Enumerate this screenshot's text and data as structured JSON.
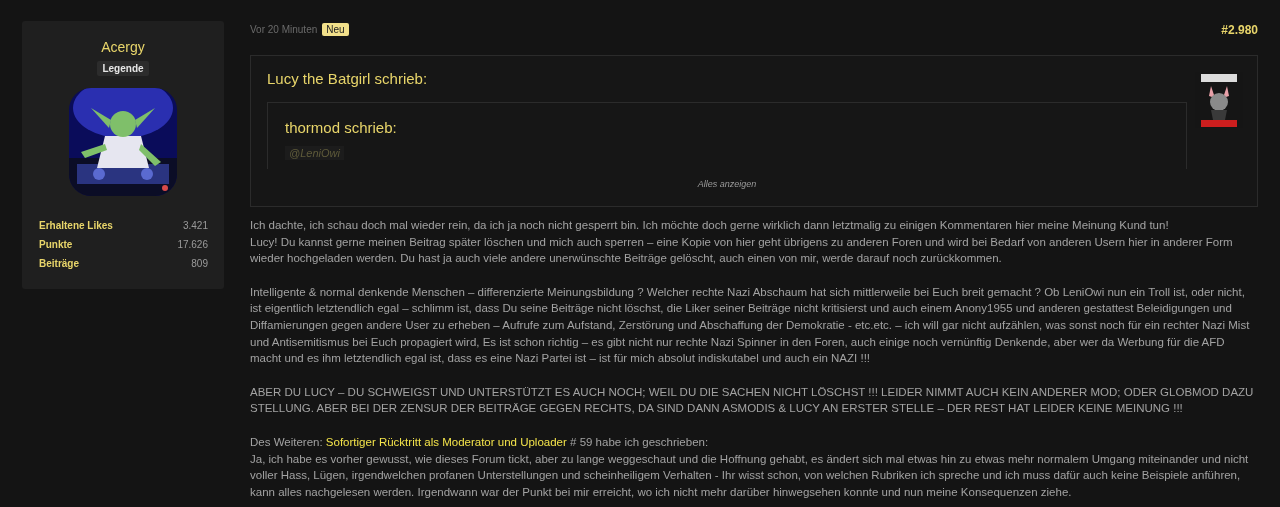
{
  "user": {
    "name": "Acergy",
    "rank": "Legende",
    "stats": [
      {
        "label": "Erhaltene Likes",
        "value": "3.421"
      },
      {
        "label": "Punkte",
        "value": "17.626"
      },
      {
        "label": "Beiträge",
        "value": "809"
      }
    ]
  },
  "post": {
    "time": "Vor 20 Minuten",
    "badge": "Neu",
    "number": "#2.980",
    "quote": {
      "author": "Lucy the Batgirl schrieb:",
      "nested": {
        "author": "thormod schrieb:",
        "mention": "@LeniOwi"
      },
      "expand": "Alles anzeigen"
    },
    "paragraphs": [
      {
        "lines": [
          {
            "text": "Ich dachte, ich schau doch mal wieder rein, da ich ja noch nicht gesperrt bin. Ich möchte doch gerne wirklich dann letztmalig zu einigen Kommentaren hier meine Meinung Kund tun!"
          },
          {
            "text": "Lucy! Du kannst gerne meinen Beitrag später löschen und mich auch sperren – eine Kopie von hier geht übrigens zu anderen Foren und wird bei Bedarf von anderen Usern hier in anderer Form wieder hochgeladen werden. Du hast ja auch viele andere unerwünschte Beiträge gelöscht, auch einen von mir, werde darauf noch zurückkommen."
          }
        ]
      },
      {
        "lines": [
          {
            "text": "Intelligente & normal denkende Menschen – differenzierte Meinungsbildung ? Welcher rechte Nazi Abschaum hat sich mittlerweile bei Euch breit gemacht ? Ob LeniOwi nun ein Troll ist, oder nicht, ist eigentlich letztendlich egal – schlimm ist, dass Du seine Beiträge nicht löschst, die Liker seiner Beiträge nicht kritisierst und auch einem Anony1955 und anderen gestattest Beleidigungen und Diffamierungen gegen andere User zu erheben – Aufrufe zum Aufstand, Zerstörung und Abschaffung der Demokratie - etc.etc. – ich will gar nicht aufzählen, was sonst noch für ein rechter Nazi Mist und Antisemitismus bei Euch propagiert wird, Es ist schon richtig – es gibt nicht nur rechte Nazi Spinner in den Foren, auch einige noch vernünftig Denkende, aber wer da Werbung für die AFD macht und es ihm letztendlich egal ist, dass es eine Nazi Partei ist – ist für mich absolut indiskutabel und auch ein NAZI !!!"
          }
        ]
      },
      {
        "lines": [
          {
            "text": "ABER DU LUCY – DU SCHWEIGST UND UNTERSTÜTZT ES AUCH NOCH; WEIL DU DIE SACHEN NICHT LÖSCHST !!! LEIDER NIMMT AUCH KEIN ANDERER MOD; ODER GLOBMOD DAZU STELLUNG. ABER BEI DER ZENSUR DER BEITRÄGE GEGEN RECHTS, DA SIND DANN ASMODIS & LUCY AN ERSTER STELLE – DER REST HAT LEIDER KEINE MEINUNG !!!"
          }
        ]
      },
      {
        "lines": [
          {
            "text": "Des Weiteren: ",
            "link": "Sofortiger Rücktritt als Moderator und Uploader",
            "after": " # 59 habe ich geschrieben:"
          },
          {
            "text": "Ja, ich habe es vorher gewusst, wie dieses Forum tickt, aber zu lange weggeschaut und die Hoffnung gehabt, es ändert sich mal etwas hin zu etwas mehr normalem Umgang miteinander und nicht voller Hass, Lügen, irgendwelchen profanen Unterstellungen und scheinheiligem Verhalten - Ihr wisst schon, von welchen Rubriken ich spreche und ich muss dafür auch keine Beispiele anführen, kann alles nachgelesen werden. Irgendwann war der Punkt bei mir erreicht, wo ich nicht mehr darüber hinwegsehen konnte und nun meine Konsequenzen ziehe."
          }
        ]
      }
    ]
  }
}
